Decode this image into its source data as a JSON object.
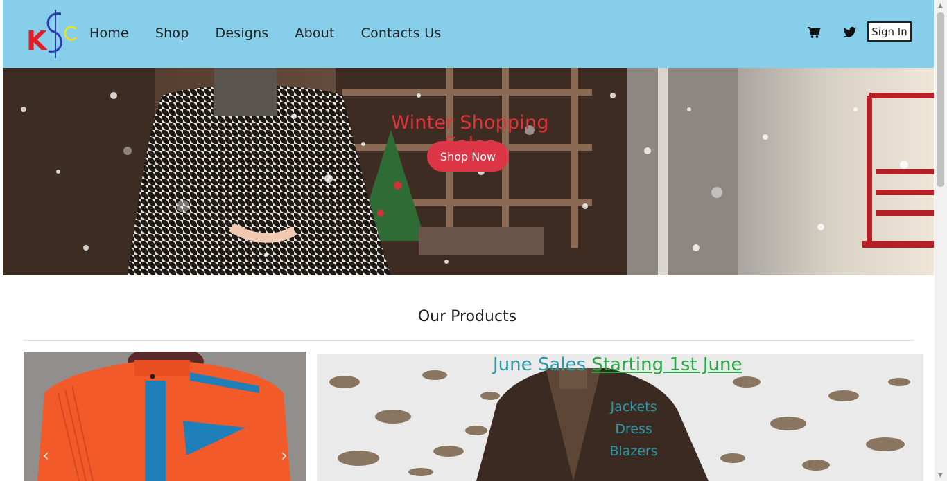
{
  "header": {
    "logo_letters": "KSC",
    "nav": [
      "Home",
      "Shop",
      "Designs",
      "About",
      "Contacts Us"
    ],
    "cart_icon": "shopping-cart-icon",
    "twitter_icon": "twitter-icon",
    "signin_label": "Sign In",
    "bg_color": "#87ceeb"
  },
  "hero": {
    "title": "Winter Shopping Sales",
    "button_label": "Shop Now",
    "title_color": "#e0343a",
    "button_color": "#dc3545"
  },
  "products": {
    "section_title": "Our Products",
    "carousel_prev_icon": "chevron-left-icon",
    "carousel_next_icon": "chevron-right-icon"
  },
  "promo": {
    "title_part1": "June Sales",
    "title_part2": "Starting 1st June",
    "items": [
      "Jackets",
      "Dress",
      "Blazers"
    ],
    "text_color": "#2a9aa8",
    "highlight_color": "#28a745"
  }
}
